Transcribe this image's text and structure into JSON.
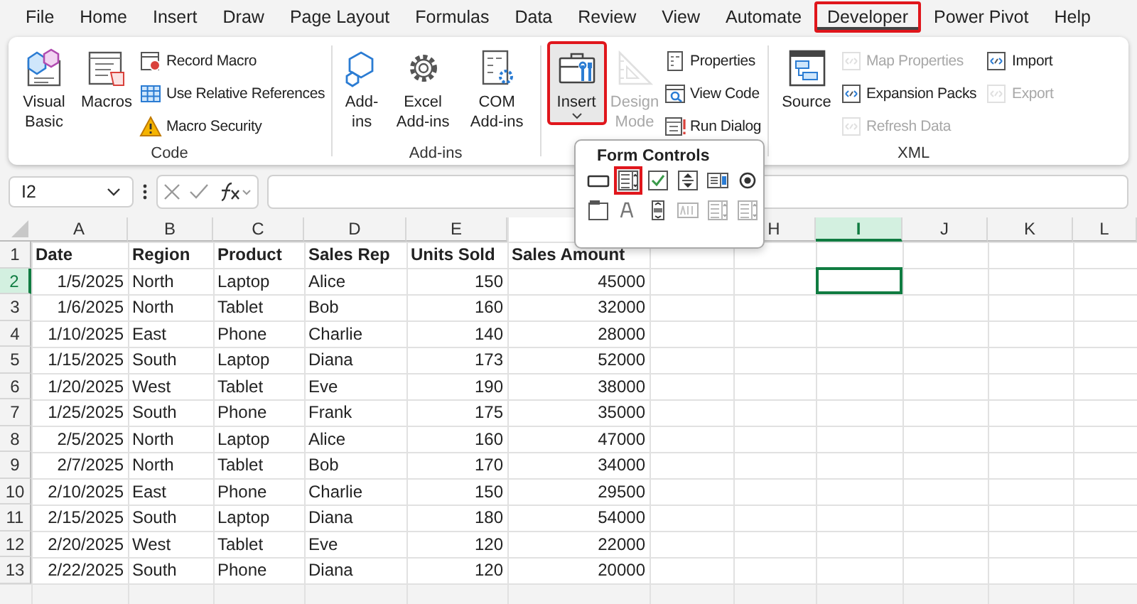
{
  "menu_tabs": [
    {
      "label": "File",
      "selected": false,
      "highlighted": false
    },
    {
      "label": "Home",
      "selected": false,
      "highlighted": false
    },
    {
      "label": "Insert",
      "selected": false,
      "highlighted": false
    },
    {
      "label": "Draw",
      "selected": false,
      "highlighted": false
    },
    {
      "label": "Page Layout",
      "selected": false,
      "highlighted": false
    },
    {
      "label": "Formulas",
      "selected": false,
      "highlighted": false
    },
    {
      "label": "Data",
      "selected": false,
      "highlighted": false
    },
    {
      "label": "Review",
      "selected": false,
      "highlighted": false
    },
    {
      "label": "View",
      "selected": false,
      "highlighted": false
    },
    {
      "label": "Automate",
      "selected": false,
      "highlighted": false
    },
    {
      "label": "Developer",
      "selected": true,
      "highlighted": true
    },
    {
      "label": "Power Pivot",
      "selected": false,
      "highlighted": false
    },
    {
      "label": "Help",
      "selected": false,
      "highlighted": false
    }
  ],
  "ribbon_groups": [
    {
      "label": "Code",
      "large": [
        {
          "label": "Visual Basic",
          "disabled": false,
          "highlighted": false
        },
        {
          "label": "Macros",
          "disabled": false,
          "highlighted": false
        }
      ],
      "small": [
        {
          "label": "Record Macro",
          "disabled": false
        },
        {
          "label": "Use Relative References",
          "disabled": false
        },
        {
          "label": "Macro Security",
          "disabled": false
        }
      ]
    },
    {
      "label": "Add-ins",
      "large": [
        {
          "label": "Add-ins",
          "disabled": false,
          "highlighted": false
        },
        {
          "label": "Excel Add-ins",
          "disabled": false,
          "highlighted": false
        },
        {
          "label": "COM Add-ins",
          "disabled": false,
          "highlighted": false
        }
      ]
    },
    {
      "large": [
        {
          "label": "Insert",
          "disabled": false,
          "highlighted": true,
          "expanded": true
        },
        {
          "label": "Design Mode",
          "disabled": true,
          "highlighted": false
        }
      ],
      "small": [
        {
          "label": "Properties",
          "disabled": false
        },
        {
          "label": "View Code",
          "disabled": false
        },
        {
          "label": "Run Dialog",
          "disabled": false
        }
      ]
    },
    {
      "label": "XML",
      "large": [
        {
          "label": "Source",
          "disabled": false,
          "highlighted": false
        }
      ],
      "small": [
        {
          "label": "Map Properties",
          "disabled": true
        },
        {
          "label": "Expansion Packs",
          "disabled": false
        },
        {
          "label": "Refresh Data",
          "disabled": true
        },
        {
          "label": "Import",
          "disabled": false
        },
        {
          "label": "Export",
          "disabled": true
        }
      ]
    }
  ],
  "formula_bar": {
    "name_box": "I2"
  },
  "form_controls": {
    "title": "Form Controls",
    "controls": [
      {
        "disabled": false,
        "highlighted": false
      },
      {
        "disabled": false,
        "highlighted": true
      },
      {
        "disabled": false,
        "highlighted": false
      },
      {
        "disabled": false,
        "highlighted": false
      },
      {
        "disabled": false,
        "highlighted": false
      },
      {
        "disabled": false,
        "highlighted": false
      },
      {
        "disabled": false,
        "highlighted": false
      },
      {
        "disabled": false,
        "highlighted": false
      },
      {
        "disabled": false,
        "highlighted": false
      },
      {
        "disabled": true,
        "highlighted": false
      },
      {
        "disabled": true,
        "highlighted": false
      },
      {
        "disabled": true,
        "highlighted": false
      }
    ]
  },
  "sheet": {
    "columns": [
      {
        "letter": "A",
        "selected": false
      },
      {
        "letter": "B",
        "selected": false
      },
      {
        "letter": "C",
        "selected": false
      },
      {
        "letter": "D",
        "selected": false
      },
      {
        "letter": "E",
        "selected": false
      },
      {},
      {},
      {
        "letter": "H",
        "selected": false
      },
      {
        "letter": "I",
        "selected": true
      },
      {
        "letter": "J",
        "selected": false
      },
      {
        "letter": "K",
        "selected": false
      },
      {
        "letter": "L",
        "selected": false
      }
    ],
    "rows": [
      {
        "number": "1",
        "selected": false,
        "header": true,
        "cells": [
          "Date",
          "Region",
          "Product",
          "Sales Rep",
          "Units Sold",
          "Sales Amount"
        ]
      },
      {
        "number": "2",
        "selected": true,
        "header": false,
        "cells": [
          "1/5/2025",
          "North",
          "Laptop",
          "Alice",
          "150",
          "45000"
        ]
      },
      {
        "number": "3",
        "selected": false,
        "header": false,
        "cells": [
          "1/6/2025",
          "North",
          "Tablet",
          "Bob",
          "160",
          "32000"
        ]
      },
      {
        "number": "4",
        "selected": false,
        "header": false,
        "cells": [
          "1/10/2025",
          "East",
          "Phone",
          "Charlie",
          "140",
          "28000"
        ]
      },
      {
        "number": "5",
        "selected": false,
        "header": false,
        "cells": [
          "1/15/2025",
          "South",
          "Laptop",
          "Diana",
          "173",
          "52000"
        ]
      },
      {
        "number": "6",
        "selected": false,
        "header": false,
        "cells": [
          "1/20/2025",
          "West",
          "Tablet",
          "Eve",
          "190",
          "38000"
        ]
      },
      {
        "number": "7",
        "selected": false,
        "header": false,
        "cells": [
          "1/25/2025",
          "South",
          "Phone",
          "Frank",
          "175",
          "35000"
        ]
      },
      {
        "number": "8",
        "selected": false,
        "header": false,
        "cells": [
          "2/5/2025",
          "North",
          "Laptop",
          "Alice",
          "160",
          "47000"
        ]
      },
      {
        "number": "9",
        "selected": false,
        "header": false,
        "cells": [
          "2/7/2025",
          "North",
          "Tablet",
          "Bob",
          "170",
          "34000"
        ]
      },
      {
        "number": "10",
        "selected": false,
        "header": false,
        "cells": [
          "2/10/2025",
          "East",
          "Phone",
          "Charlie",
          "150",
          "29500"
        ]
      },
      {
        "number": "11",
        "selected": false,
        "header": false,
        "cells": [
          "2/15/2025",
          "South",
          "Laptop",
          "Diana",
          "180",
          "54000"
        ]
      },
      {
        "number": "12",
        "selected": false,
        "header": false,
        "cells": [
          "2/20/2025",
          "West",
          "Tablet",
          "Eve",
          "120",
          "22000"
        ]
      },
      {
        "number": "13",
        "selected": false,
        "header": false,
        "cells": [
          "2/22/2025",
          "South",
          "Phone",
          "Diana",
          "120",
          "20000"
        ]
      }
    ]
  }
}
